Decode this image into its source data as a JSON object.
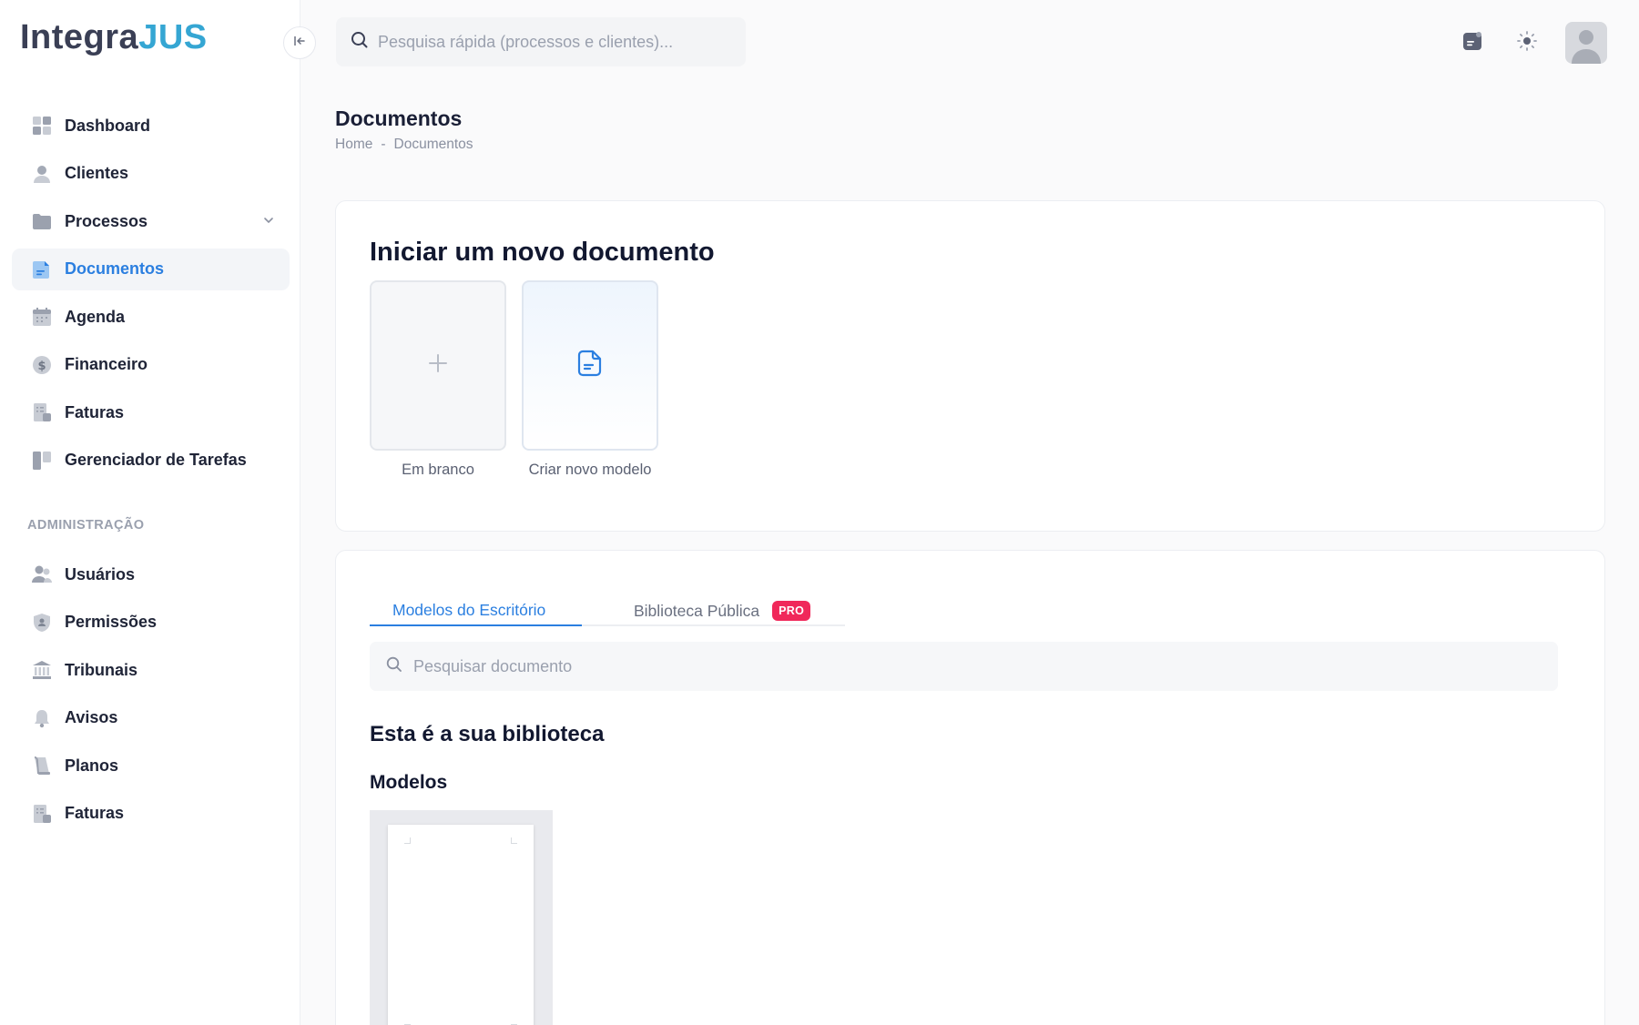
{
  "app": {
    "logo_part1": "Integra",
    "logo_part2": "JUS"
  },
  "sidebar": {
    "items": [
      {
        "label": "Dashboard",
        "icon": "grid-icon"
      },
      {
        "label": "Clientes",
        "icon": "user-icon"
      },
      {
        "label": "Processos",
        "icon": "folder-icon"
      },
      {
        "label": "Documentos",
        "icon": "document-icon",
        "active": true
      },
      {
        "label": "Agenda",
        "icon": "calendar-icon"
      },
      {
        "label": "Financeiro",
        "icon": "dollar-icon"
      },
      {
        "label": "Faturas",
        "icon": "invoice-icon"
      },
      {
        "label": "Gerenciador de Tarefas",
        "icon": "kanban-icon"
      }
    ],
    "section_title": "ADMINISTRAÇÃO",
    "admin_items": [
      {
        "label": "Usuários",
        "icon": "users-icon"
      },
      {
        "label": "Permissões",
        "icon": "shield-user-icon"
      },
      {
        "label": "Tribunais",
        "icon": "court-icon"
      },
      {
        "label": "Avisos",
        "icon": "bell-icon"
      },
      {
        "label": "Planos",
        "icon": "scroll-icon"
      },
      {
        "label": "Faturas",
        "icon": "invoice-icon"
      }
    ]
  },
  "topbar": {
    "search_placeholder": "Pesquisa rápida (processos e clientes)..."
  },
  "page": {
    "title": "Documentos",
    "breadcrumb": [
      "Home",
      "Documentos"
    ],
    "breadcrumb_sep": "-"
  },
  "new_document": {
    "title": "Iniciar um novo documento",
    "blank_label": "Em branco",
    "model_label": "Criar novo modelo"
  },
  "library": {
    "tabs": [
      {
        "label": "Modelos do Escritório",
        "active": true
      },
      {
        "label": "Biblioteca Pública",
        "badge": "PRO"
      }
    ],
    "search_placeholder": "Pesquisar documento",
    "heading": "Esta é a sua biblioteca",
    "models_heading": "Modelos"
  },
  "colors": {
    "accent": "#2b7fe0",
    "badge": "#f0285a",
    "logo_dark": "#3a3f55",
    "logo_light": "#35a6d3"
  }
}
